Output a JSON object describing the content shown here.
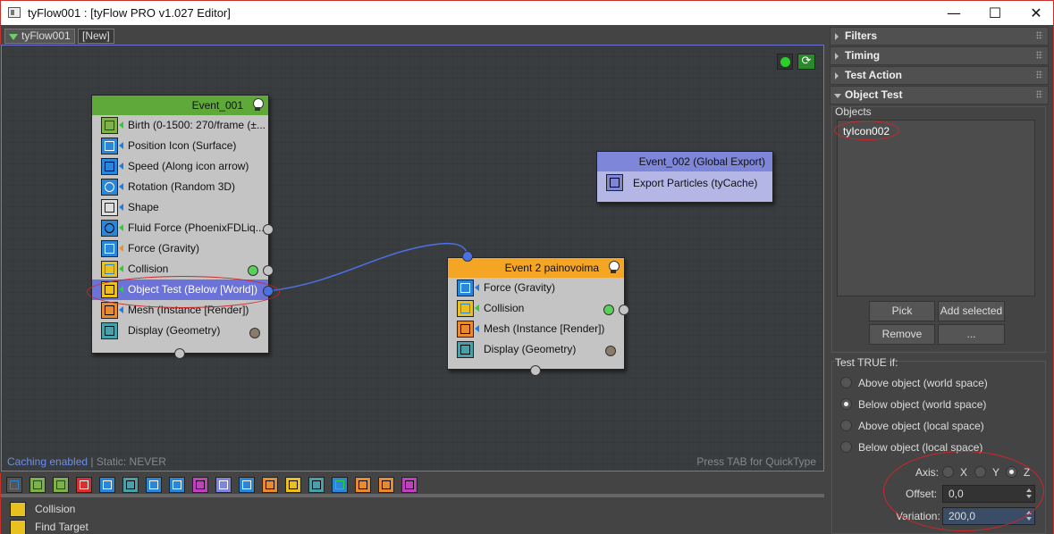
{
  "window": {
    "title": "tyFlow001 : [tyFlow PRO v1.027 Editor]",
    "minimize": "—",
    "maximize": "☐",
    "close": "✕"
  },
  "tabs": [
    {
      "label": "tyFlow001",
      "active": true
    },
    {
      "label": "[New]",
      "active": false
    }
  ],
  "colors": {
    "accent": "#6b72d8",
    "event_green": "#5fa83a",
    "event_blue": "#7d86d8",
    "event_orange": "#f5a524",
    "annotation_red": "#d0262a"
  },
  "events": {
    "event1": {
      "title": "Event_001",
      "operators": [
        {
          "label": "Birth (0-1500: 270/frame (±...",
          "icon": "birth-icon"
        },
        {
          "label": "Position Icon (Surface)",
          "icon": "position-icon"
        },
        {
          "label": "Speed (Along icon arrow)",
          "icon": "speed-icon"
        },
        {
          "label": "Rotation (Random 3D)",
          "icon": "rotation-icon"
        },
        {
          "label": "Shape",
          "icon": "shape-icon"
        },
        {
          "label": "Fluid Force (PhoenixFDLiq...",
          "icon": "fluid-force-icon"
        },
        {
          "label": "Force (Gravity)",
          "icon": "force-icon"
        },
        {
          "label": "Collision",
          "icon": "collision-icon"
        },
        {
          "label": "Object Test (Below [World])",
          "icon": "object-test-icon"
        },
        {
          "label": "Mesh (Instance [Render])",
          "icon": "mesh-icon"
        },
        {
          "label": "Display (Geometry)",
          "icon": "display-icon"
        }
      ]
    },
    "event2": {
      "title": "Event_002 (Global Export)",
      "operators": [
        {
          "label": "Export Particles (tyCache)",
          "icon": "export-icon"
        }
      ]
    },
    "event3": {
      "title": "Event 2 painovoima",
      "operators": [
        {
          "label": "Force (Gravity)",
          "icon": "force-icon"
        },
        {
          "label": "Collision",
          "icon": "collision-icon"
        },
        {
          "label": "Mesh (Instance [Render])",
          "icon": "mesh-icon"
        },
        {
          "label": "Display (Geometry)",
          "icon": "display-icon"
        }
      ]
    }
  },
  "status": {
    "caching": "Caching enabled",
    "separator": " | ",
    "static": "Static: NEVER",
    "quicktype": "Press TAB for QuickType"
  },
  "oplist": {
    "items": [
      {
        "label": "Collision",
        "icon": "collision-icon"
      },
      {
        "label": "Find Target",
        "icon": "find-target-icon"
      }
    ]
  },
  "panel": {
    "rollouts": {
      "filters": "Filters",
      "timing": "Timing",
      "test_action": "Test Action",
      "object_test": "Object Test"
    },
    "objects_label": "Objects",
    "objects": [
      "tyIcon002"
    ],
    "buttons": {
      "pick": "Pick",
      "add_selected": "Add selected",
      "remove": "Remove",
      "more": "..."
    },
    "test_label": "Test TRUE if:",
    "tests": [
      {
        "label": "Above object (world space)",
        "selected": false
      },
      {
        "label": "Below object (world space)",
        "selected": true
      },
      {
        "label": "Above object (local space)",
        "selected": false
      },
      {
        "label": "Below object (local space)",
        "selected": false
      }
    ],
    "axis_label": "Axis:",
    "axes": [
      {
        "label": "X",
        "selected": false
      },
      {
        "label": "Y",
        "selected": false
      },
      {
        "label": "Z",
        "selected": true
      }
    ],
    "offset_label": "Offset:",
    "offset_value": "0,0",
    "variation_label": "Variation:",
    "variation_value": "200,0"
  }
}
